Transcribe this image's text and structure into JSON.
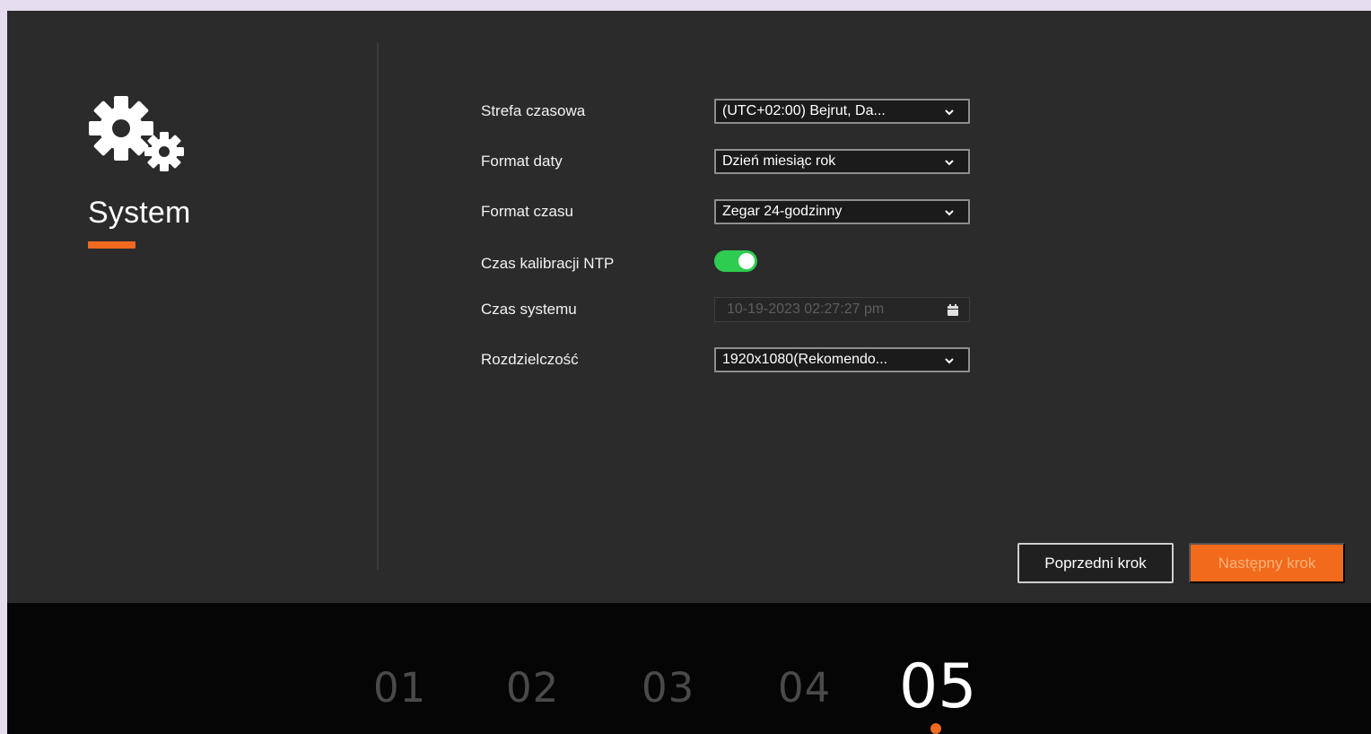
{
  "section": {
    "title": "System",
    "icon": "gears-icon"
  },
  "form": {
    "rows": [
      {
        "label": "Strefa czasowa",
        "value": "(UTC+02:00) Bejrut, Da..."
      },
      {
        "label": "Format daty",
        "value": "Dzień miesiąc rok"
      },
      {
        "label": "Format czasu",
        "value": "Zegar 24-godzinny"
      },
      {
        "label": "Czas kalibracji NTP",
        "enabled": true
      },
      {
        "label": "Czas systemu",
        "value": "10-19-2023 02:27:27 pm"
      },
      {
        "label": "Rozdzielczość",
        "value": "1920x1080(Rekomendo..."
      }
    ]
  },
  "buttons": {
    "prev": "Poprzedni krok",
    "next": "Następny krok"
  },
  "steps": [
    "01",
    "02",
    "03",
    "04",
    "05"
  ],
  "active_step": "05",
  "colors": {
    "accent": "#f06a22",
    "toggle_on": "#2ecc50",
    "background": "#2b2b2b",
    "stepbar": "#050505"
  }
}
